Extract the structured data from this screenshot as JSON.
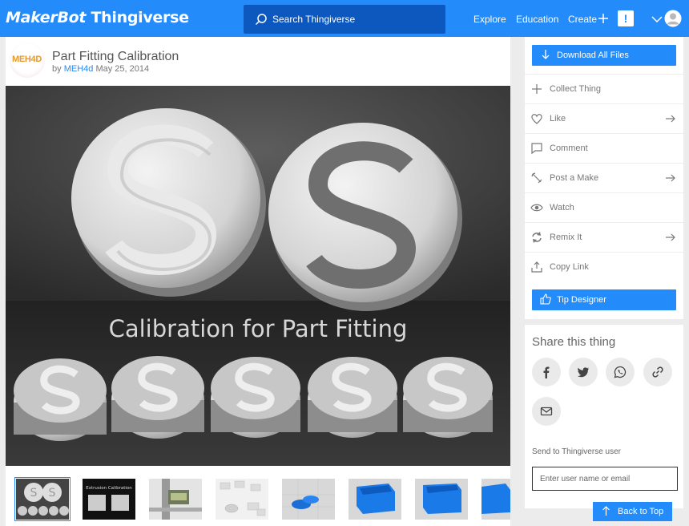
{
  "header": {
    "logo_brand": "MakerBot",
    "logo_product": "Thingiverse",
    "search_placeholder": "Search Thingiverse",
    "nav": [
      {
        "label": "Explore"
      },
      {
        "label": "Education"
      },
      {
        "label": "Create"
      }
    ],
    "notification_glyph": "!"
  },
  "thing": {
    "designer_logo_text": "MEH4D",
    "title": "Part Fitting Calibration",
    "by_prefix": "by",
    "author": "MEH4d",
    "date": "May 25, 2014",
    "hero_caption": "Calibration for Part Fitting"
  },
  "gallery": {
    "thumb_caption_2": "Extrusion Calibration",
    "thumbnails": [
      {
        "icon": "coins-photo"
      },
      {
        "icon": "extrusion-calibration-photo"
      },
      {
        "icon": "caliper-photo"
      },
      {
        "icon": "white-parts-photo"
      },
      {
        "icon": "blue-coin-render"
      },
      {
        "icon": "blue-box-render"
      },
      {
        "icon": "blue-box-render"
      },
      {
        "icon": "blue-box-render"
      }
    ]
  },
  "sidebar": {
    "download_label": "Download All Files",
    "actions": [
      {
        "label": "Collect Thing",
        "icon": "plus-icon"
      },
      {
        "label": "Like",
        "icon": "heart-icon"
      },
      {
        "label": "Comment",
        "icon": "comment-icon"
      },
      {
        "label": "Post a Make",
        "icon": "pencil-icon"
      },
      {
        "label": "Watch",
        "icon": "eye-icon"
      },
      {
        "label": "Remix It",
        "icon": "remix-icon"
      },
      {
        "label": "Copy Link",
        "icon": "share-icon"
      }
    ],
    "tip_label": "Tip Designer"
  },
  "share": {
    "title": "Share this thing",
    "send_label": "Send to Thingiverse user",
    "input_placeholder": "Enter user name or email",
    "networks": [
      "facebook-icon",
      "twitter-icon",
      "whatsapp-icon",
      "link-icon",
      "email-icon"
    ]
  },
  "back_to_top": "Back to Top",
  "colors": {
    "brand_blue": "#248bfb",
    "search_bg": "#0d58bf",
    "page_bg": "#ececec"
  }
}
